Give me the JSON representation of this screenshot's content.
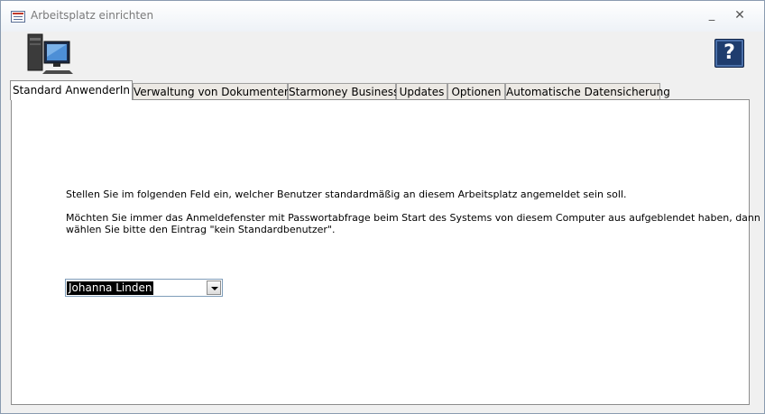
{
  "window": {
    "title": "Arbeitsplatz einrichten",
    "minimize_label": "_",
    "close_label": "✕"
  },
  "help": {
    "label": "?"
  },
  "tabs": [
    {
      "label": "Standard AnwenderIn",
      "active": true
    },
    {
      "label": "Verwaltung von Dokumenten",
      "active": false
    },
    {
      "label": "Starmoney Business",
      "active": false
    },
    {
      "label": "Updates",
      "active": false
    },
    {
      "label": "Optionen",
      "active": false
    },
    {
      "label": "Automatische Datensicherung",
      "active": false
    }
  ],
  "panel": {
    "instruction": "Stellen Sie im folgenden Feld ein, welcher Benutzer standardmäßig an diesem Arbeitsplatz angemeldet sein soll.",
    "hint_line1": "Möchten Sie immer das Anmeldefenster mit Passwortabfrage beim Start des Systems von diesem Computer aus aufgeblendet haben, dann",
    "hint_line2": "wählen Sie bitte den Eintrag \"kein Standardbenutzer\".",
    "user_select": {
      "value": "Johanna Linden"
    }
  },
  "icons": {
    "computer": "computer-icon",
    "help": "help-icon",
    "dropdown": "chevron-down-icon"
  }
}
